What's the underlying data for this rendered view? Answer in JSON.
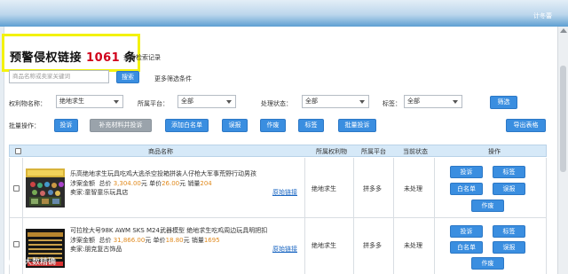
{
  "topbar": {
    "user": "计冬蕾"
  },
  "header": {
    "title_prefix": "预警侵权链接",
    "count": "1061",
    "title_suffix": "条",
    "history_link": "查看检索记录"
  },
  "search": {
    "placeholder": "商品名称或卖家关键词",
    "button": "搜索",
    "more_filters": "更多筛选条件"
  },
  "filters": {
    "rights_label": "权利物名称：",
    "rights_value": "绝地求生",
    "platform_label": "所属平台：",
    "platform_value": "全部",
    "status_label": "处理状态：",
    "status_value": "全部",
    "tag_label": "标签：",
    "tag_value": "全部",
    "filter_button": "筛选"
  },
  "batch": {
    "label": "批量操作：",
    "complain": "投诉",
    "supplement": "补充材料并投诉",
    "whitelist": "添加白名单",
    "misreport": "误报",
    "void": "作废",
    "tag": "标签",
    "batch_complain": "批量投诉",
    "export": "导出表格"
  },
  "table": {
    "headers": {
      "name": "商品名称",
      "rights": "所属权利物",
      "platform": "所属平台",
      "status": "当前状态",
      "actions": "操作"
    },
    "rows": [
      {
        "name": "乐高绝地求生玩具吃鸡大逃杀空投箱拼装人仔枪大军事荒野行动男孩",
        "sales_label": "涉案金额",
        "total_label": "总价",
        "total": "3,304.00",
        "unit_label": "元 单价",
        "unit_price": "26.00",
        "qty_label": "元 销量",
        "qty": "204",
        "shop": "卖家:童智童乐玩具店",
        "orig_link": "原始链接",
        "rights": "绝地求生",
        "platform": "拼多多",
        "status": "未处理",
        "actions": {
          "complain": "投诉",
          "tag": "标签",
          "whitelist": "白名单",
          "misreport": "误报",
          "void": "作废"
        }
      },
      {
        "name": "可拉栓大号98K AWM SKS M24武器模型 绝地求生吃鸡周边玩具明把扣",
        "sales_label": "涉案金额",
        "total_label": "总价",
        "total": "31,866.00",
        "unit_label": "元 单价",
        "unit_price": "18.80",
        "qty_label": "元 销量",
        "qty": "1695",
        "shop": "卖家:朋克复古饰品",
        "orig_link": "原始链接",
        "rights": "绝地求生",
        "platform": "拼多多",
        "status": "未处理",
        "actions": {
          "complain": "投诉",
          "tag": "标签",
          "whitelist": "白名单",
          "misreport": "误报",
          "void": "作废"
        }
      }
    ]
  },
  "watermark": "大数精确"
}
